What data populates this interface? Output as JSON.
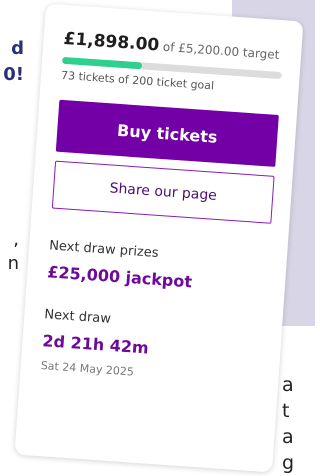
{
  "background": {
    "heading_fragment": [
      "d",
      "0!"
    ],
    "left_body_fragment": [
      ",",
      "n"
    ],
    "right_body_fragment": [
      "a",
      "t",
      "a",
      "g"
    ]
  },
  "card": {
    "raised_amount": "£1,898.00",
    "target_text": "of £5,200.00 target",
    "progress_fraction": 0.365,
    "tickets_text": "73 tickets of 200 ticket goal",
    "buy_label": "Buy tickets",
    "share_label": "Share our page",
    "prizes_label": "Next draw prizes",
    "jackpot_text": "£25,000 jackpot",
    "next_draw_label": "Next draw",
    "countdown": "2d  21h  42m",
    "draw_date": "Sat 24 May 2025"
  },
  "colors": {
    "accent": "#7200a6",
    "progress": "#2fd08c",
    "heading": "#2b2f77"
  }
}
